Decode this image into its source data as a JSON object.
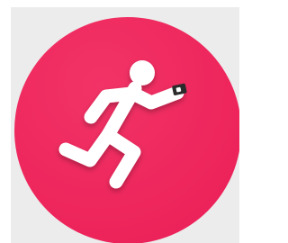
{
  "app_icon": {
    "icon": "running-person-icon",
    "colors": {
      "circle": "#ec2259",
      "circle_highlight": "#f23366",
      "figure": "#ffffff",
      "device": "#2b2b2b",
      "backdrop": "#ececec"
    }
  }
}
